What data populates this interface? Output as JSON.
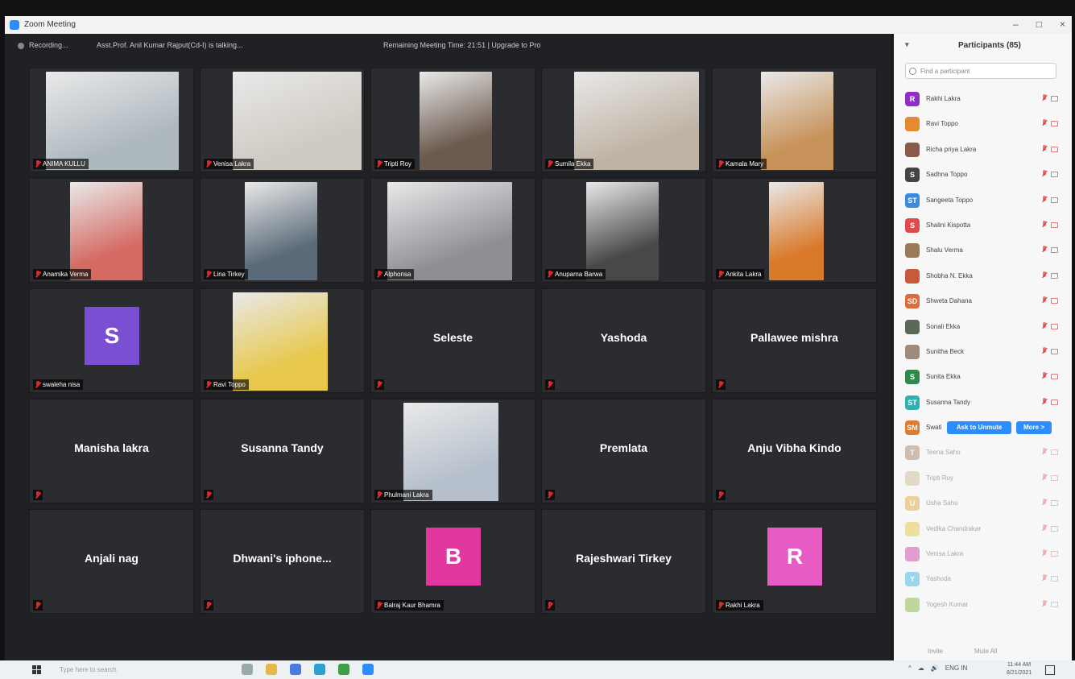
{
  "window": {
    "title": "Zoom Meeting",
    "controls": [
      "–",
      "□",
      "×"
    ]
  },
  "meeting_bar": {
    "recording": "Recording...",
    "talking": "Asst.Prof. Anil Kumar Rajput(Cd-I) is talking...",
    "remaining": "Remaining Meeting Time: 21:51 | Upgrade to Pro"
  },
  "tiles": [
    {
      "name": "ANIMA KULLU",
      "kind": "video",
      "color": "#aeb8bf"
    },
    {
      "name": "Venisa Lakra",
      "kind": "video",
      "color": "#cfcac2"
    },
    {
      "name": "Tripti Roy",
      "kind": "video",
      "color": "#6b5a4e"
    },
    {
      "name": "Sumila Ekka",
      "kind": "video",
      "color": "#bfb3a4"
    },
    {
      "name": "Kamala Mary",
      "kind": "video",
      "color": "#c7925a"
    },
    {
      "name": "Anamika Verma",
      "kind": "video",
      "color": "#d46a62"
    },
    {
      "name": "Lina Tirkey",
      "kind": "video",
      "color": "#5a6a78"
    },
    {
      "name": "Alphonsa",
      "kind": "video",
      "color": "#8d8f95"
    },
    {
      "name": "Anupama Barwa",
      "kind": "video",
      "color": "#4a4748"
    },
    {
      "name": "Ankita Lakra",
      "kind": "video",
      "color": "#d9792a"
    },
    {
      "name": "swaleha nisa",
      "kind": "avatar",
      "letter": "S",
      "color": "#7b4fd3"
    },
    {
      "name": "Ravi Toppo",
      "kind": "video",
      "color": "#e7c84a"
    },
    {
      "name": "",
      "kind": "name",
      "display": "Seleste"
    },
    {
      "name": "",
      "kind": "name",
      "display": "Yashoda"
    },
    {
      "name": "",
      "kind": "name",
      "display": "Pallawee mishra"
    },
    {
      "name": "",
      "kind": "name",
      "display": "Manisha lakra"
    },
    {
      "name": "",
      "kind": "name",
      "display": "Susanna Tandy"
    },
    {
      "name": "Phulmani Lakra",
      "kind": "video",
      "color": "#b6c0cc"
    },
    {
      "name": "",
      "kind": "name",
      "display": "Premlata"
    },
    {
      "name": "",
      "kind": "name",
      "display": "Anju Vibha  Kindo"
    },
    {
      "name": "",
      "kind": "name",
      "display": "Anjali nag"
    },
    {
      "name": "",
      "kind": "name",
      "display": "Dhwani's  iphone..."
    },
    {
      "name": "Balraj Kaur Bhamra",
      "kind": "avatar",
      "letter": "B",
      "color": "#e0389f"
    },
    {
      "name": "",
      "kind": "name",
      "display": "Rajeshwari Tirkey"
    },
    {
      "name": "Rakhi Lakra",
      "kind": "avatar",
      "letter": "R",
      "color": "#e65bc4"
    }
  ],
  "participants_panel": {
    "title": "Participants (85)",
    "search_placeholder": "Find a participant",
    "ask_to_unmute": "Ask to Unmute",
    "more": "More >",
    "footer": [
      "Invite",
      "Mute All"
    ],
    "rows": [
      {
        "initial": "R",
        "name": "Rakhi Lakra",
        "color": "#8e2ec4"
      },
      {
        "initial": "",
        "name": "Ravi Toppo",
        "color": "#e58a2e"
      },
      {
        "initial": "",
        "name": "Richa priya Lakra",
        "color": "#8a5a4a"
      },
      {
        "initial": "S",
        "name": "Sadhna Toppo",
        "color": "#444"
      },
      {
        "initial": "ST",
        "name": "Sangeeta Toppo",
        "color": "#3a8be0"
      },
      {
        "initial": "S",
        "name": "Shalini Kispotta",
        "color": "#e04a4a"
      },
      {
        "initial": "",
        "name": "Shalu Verma",
        "color": "#9a7a5a"
      },
      {
        "initial": "",
        "name": "Shobha N. Ekka",
        "color": "#c85a3a"
      },
      {
        "initial": "SD",
        "name": "Shweta Dahana",
        "color": "#e06a3a"
      },
      {
        "initial": "",
        "name": "Sonali Ekka",
        "color": "#5a6a5a"
      },
      {
        "initial": "",
        "name": "Sunitha Beck",
        "color": "#a08a7a"
      },
      {
        "initial": "S",
        "name": "Sunita Ekka",
        "color": "#2e8a4a"
      },
      {
        "initial": "ST",
        "name": "Susanna Tandy",
        "color": "#2eb0b0"
      },
      {
        "initial": "SM",
        "name": "Swati",
        "color": "#e07a2e"
      },
      {
        "initial": "T",
        "name": "Teena Sahu",
        "color": "#a07a5a"
      },
      {
        "initial": "",
        "name": "Tripti Roy",
        "color": "#c8b48a"
      },
      {
        "initial": "U",
        "name": "Usha Sahu",
        "color": "#e0a02e"
      },
      {
        "initial": "",
        "name": "Vedika Chandrakar",
        "color": "#e0c02e"
      },
      {
        "initial": "",
        "name": "Venisa Lakra",
        "color": "#c02ea0"
      },
      {
        "initial": "Y",
        "name": "Yashoda",
        "color": "#2eb0e0"
      },
      {
        "initial": "",
        "name": "Yogesh Kumar",
        "color": "#7ab02e"
      }
    ]
  },
  "taskbar": {
    "search": "Type here to search",
    "tray": [
      "^",
      "☁",
      "🔊",
      "ENG IN"
    ],
    "time": "11:44 AM",
    "date": "8/21/2021"
  }
}
